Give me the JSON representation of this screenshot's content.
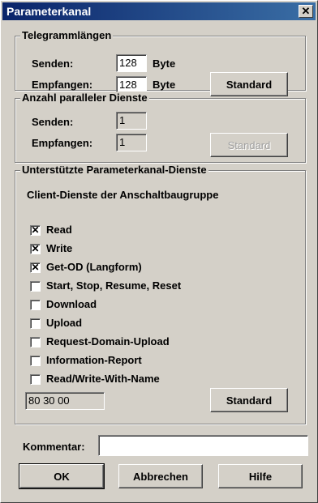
{
  "window": {
    "title": "Parameterkanal",
    "close_glyph": "✕"
  },
  "telegram": {
    "legend": "Telegrammlängen",
    "send_label": "Senden:",
    "send_value": "128",
    "send_unit": "Byte",
    "recv_label": "Empfangen:",
    "recv_value": "128",
    "recv_unit": "Byte",
    "standard": "Standard"
  },
  "parallel": {
    "legend": "Anzahl paralleler Dienste",
    "send_label": "Senden:",
    "send_value": "1",
    "recv_label": "Empfangen:",
    "recv_value": "1",
    "standard": "Standard"
  },
  "services": {
    "legend": "Unterstützte Parameterkanal-Dienste",
    "sublabel": "Client-Dienste der Anschaltbaugruppe",
    "items": [
      {
        "label": "Read",
        "checked": true
      },
      {
        "label": "Write",
        "checked": true
      },
      {
        "label": "Get-OD (Langform)",
        "checked": true
      },
      {
        "label": "Start, Stop, Resume, Reset",
        "checked": false
      },
      {
        "label": "Download",
        "checked": false
      },
      {
        "label": "Upload",
        "checked": false
      },
      {
        "label": "Request-Domain-Upload",
        "checked": false
      },
      {
        "label": "Information-Report",
        "checked": false
      },
      {
        "label": "Read/Write-With-Name",
        "checked": false
      }
    ],
    "hex_value": "80 30 00",
    "standard": "Standard"
  },
  "comment": {
    "label": "Kommentar:",
    "value": ""
  },
  "buttons": {
    "ok": "OK",
    "cancel": "Abbrechen",
    "help": "Hilfe"
  }
}
